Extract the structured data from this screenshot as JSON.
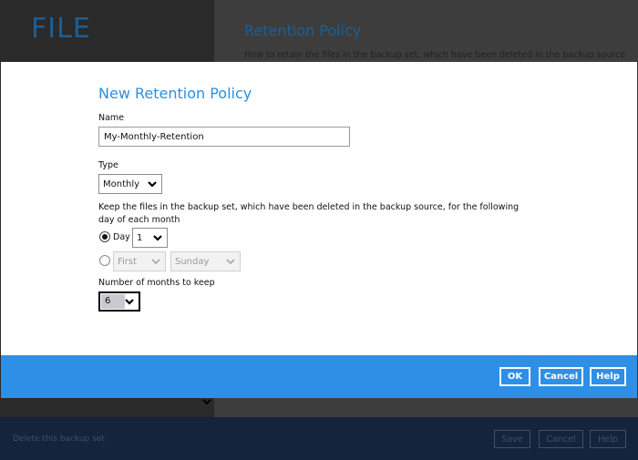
{
  "background": {
    "app_title": "FILE",
    "page_title": "Retention Policy",
    "page_description": "How to retain the files in the backup set, which have been deleted in the backup source",
    "delete_link": "Delete this backup set",
    "buttons": {
      "save": "Save",
      "cancel": "Cancel",
      "help": "Help"
    }
  },
  "dialog": {
    "title": "New Retention Policy",
    "name_label": "Name",
    "name_value": "My-Monthly-Retention",
    "type_label": "Type",
    "type_value": "Monthly",
    "keep_description": "Keep the files in the backup set, which have been deleted in the backup source, for the following day of each month",
    "day_option_label": "Day",
    "day_value": "1",
    "day_selected": true,
    "week_ordinal_value": "First",
    "weekday_value": "Sunday",
    "months_label": "Number of months to keep",
    "months_value": "6",
    "buttons": {
      "ok": "OK",
      "cancel": "Cancel",
      "help": "Help"
    }
  },
  "colors": {
    "accent": "#2e8fe6",
    "title_blue": "#2d8fdc",
    "bottom_bar": "#14243a"
  }
}
